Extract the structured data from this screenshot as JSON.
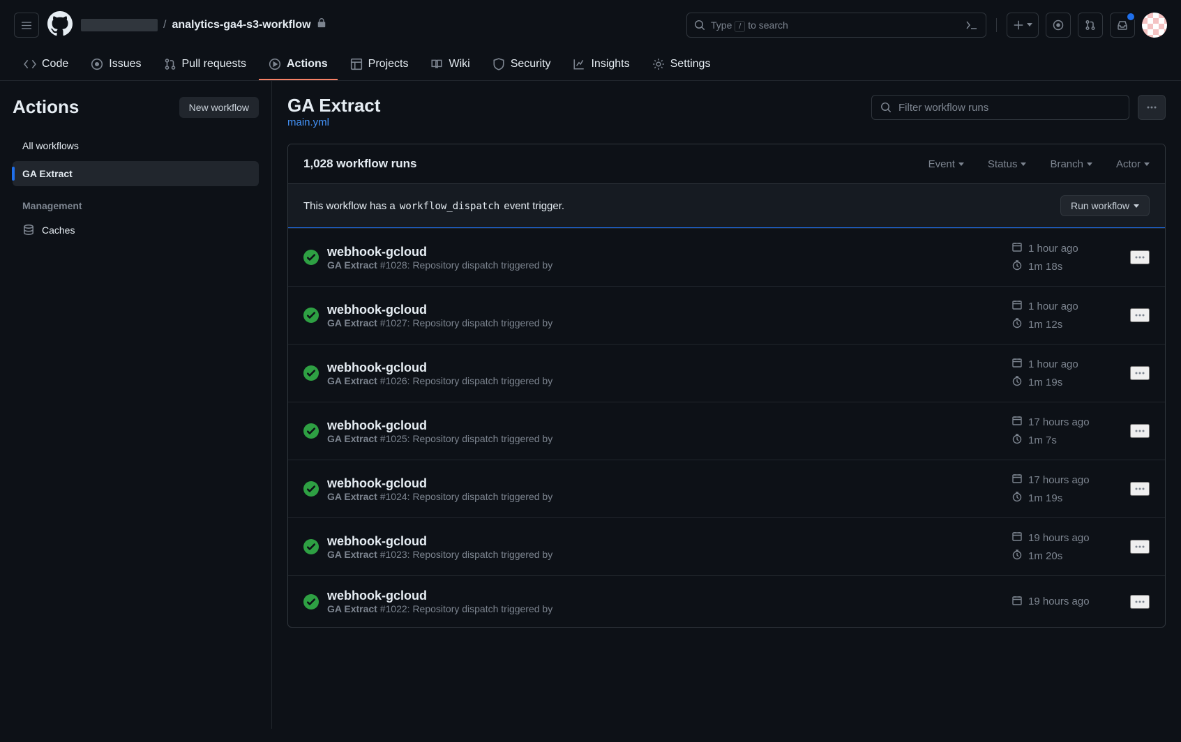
{
  "header": {
    "repo_name": "analytics-ga4-s3-workflow",
    "search_hint_prefix": "Type ",
    "search_key": "/",
    "search_hint_suffix": " to search"
  },
  "repo_nav": {
    "code": "Code",
    "issues": "Issues",
    "pull_requests": "Pull requests",
    "actions": "Actions",
    "projects": "Projects",
    "wiki": "Wiki",
    "security": "Security",
    "insights": "Insights",
    "settings": "Settings"
  },
  "sidebar": {
    "title": "Actions",
    "new_workflow": "New workflow",
    "all_workflows": "All workflows",
    "workflow_name": "GA Extract",
    "management_label": "Management",
    "caches": "Caches"
  },
  "content": {
    "title": "GA Extract",
    "file": "main.yml",
    "filter_placeholder": "Filter workflow runs",
    "runs_count": "1,028 workflow runs",
    "filter_event": "Event",
    "filter_status": "Status",
    "filter_branch": "Branch",
    "filter_actor": "Actor",
    "dispatch_prefix": "This workflow has a ",
    "dispatch_code": "workflow_dispatch",
    "dispatch_suffix": " event trigger.",
    "run_workflow_btn": "Run workflow"
  },
  "runs": [
    {
      "title": "webhook-gcloud",
      "wf": "GA Extract",
      "num": "#1028",
      "desc": ": Repository dispatch triggered by",
      "time": "1 hour ago",
      "dur": "1m 18s"
    },
    {
      "title": "webhook-gcloud",
      "wf": "GA Extract",
      "num": "#1027",
      "desc": ": Repository dispatch triggered by",
      "time": "1 hour ago",
      "dur": "1m 12s"
    },
    {
      "title": "webhook-gcloud",
      "wf": "GA Extract",
      "num": "#1026",
      "desc": ": Repository dispatch triggered by",
      "time": "1 hour ago",
      "dur": "1m 19s"
    },
    {
      "title": "webhook-gcloud",
      "wf": "GA Extract",
      "num": "#1025",
      "desc": ": Repository dispatch triggered by",
      "time": "17 hours ago",
      "dur": "1m 7s"
    },
    {
      "title": "webhook-gcloud",
      "wf": "GA Extract",
      "num": "#1024",
      "desc": ": Repository dispatch triggered by",
      "time": "17 hours ago",
      "dur": "1m 19s"
    },
    {
      "title": "webhook-gcloud",
      "wf": "GA Extract",
      "num": "#1023",
      "desc": ": Repository dispatch triggered by",
      "time": "19 hours ago",
      "dur": "1m 20s"
    },
    {
      "title": "webhook-gcloud",
      "wf": "GA Extract",
      "num": "#1022",
      "desc": ": Repository dispatch triggered by",
      "time": "19 hours ago",
      "dur": ""
    }
  ]
}
